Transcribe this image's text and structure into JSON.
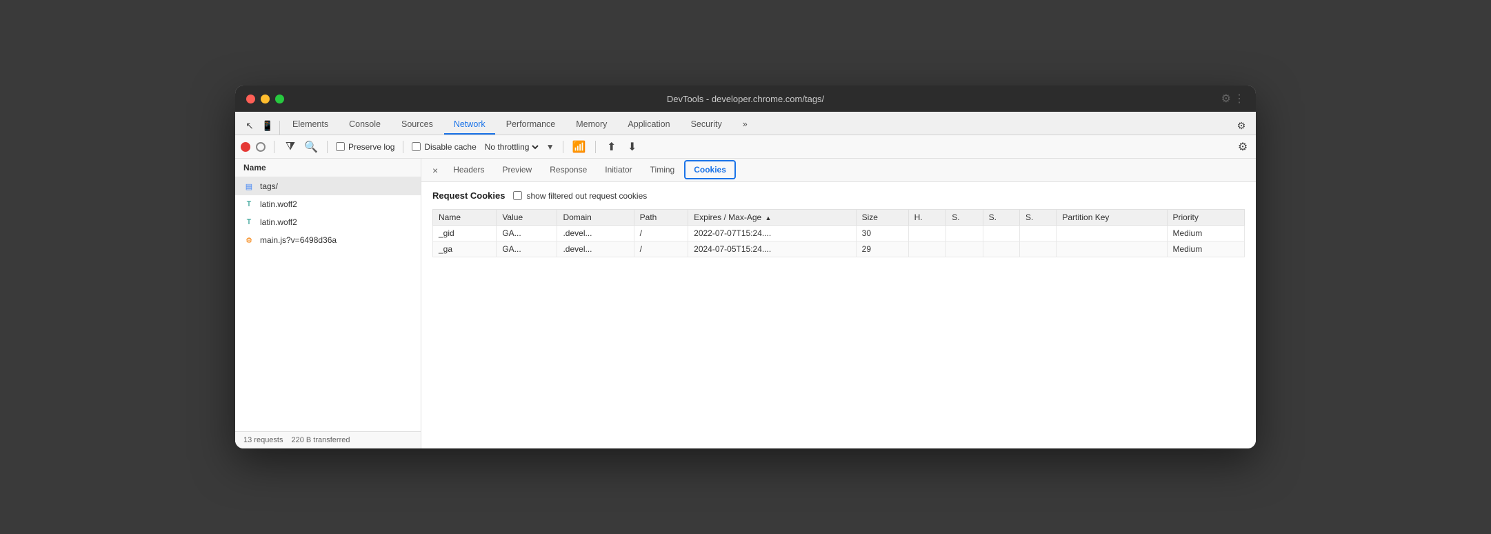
{
  "window": {
    "title": "DevTools - developer.chrome.com/tags/"
  },
  "toolbar": {
    "tabs": [
      "Elements",
      "Console",
      "Sources",
      "Network",
      "Performance",
      "Memory",
      "Application",
      "Security"
    ]
  },
  "network_toolbar": {
    "preserve_log": "Preserve log",
    "disable_cache": "Disable cache",
    "throttle": "No throttling"
  },
  "detail_tabs": {
    "close": "×",
    "tabs": [
      "Headers",
      "Preview",
      "Response",
      "Initiator",
      "Timing",
      "Cookies"
    ]
  },
  "sidebar": {
    "header": "Name",
    "items": [
      {
        "name": "tags/",
        "type": "document"
      },
      {
        "name": "latin.woff2",
        "type": "font"
      },
      {
        "name": "latin.woff2",
        "type": "font"
      },
      {
        "name": "main.js?v=6498d36a",
        "type": "script"
      }
    ],
    "footer": {
      "requests": "13 requests",
      "transferred": "220 B transferred"
    }
  },
  "cookies": {
    "section_title": "Request Cookies",
    "filter_label": "show filtered out request cookies",
    "table": {
      "headers": [
        "Name",
        "Value",
        "Domain",
        "Path",
        "Expires / Max-Age",
        "Size",
        "H.",
        "S.",
        "S.",
        "S.",
        "Partition Key",
        "Priority"
      ],
      "rows": [
        {
          "name": "_gid",
          "value": "GA...",
          "domain": ".devel...",
          "path": "/",
          "expires": "2022-07-07T15:24....",
          "size": "30",
          "h": "",
          "s1": "",
          "s2": "",
          "s3": "",
          "partition_key": "",
          "priority": "Medium"
        },
        {
          "name": "_ga",
          "value": "GA...",
          "domain": ".devel...",
          "path": "/",
          "expires": "2024-07-05T15:24....",
          "size": "29",
          "h": "",
          "s1": "",
          "s2": "",
          "s3": "",
          "partition_key": "",
          "priority": "Medium"
        }
      ]
    }
  }
}
